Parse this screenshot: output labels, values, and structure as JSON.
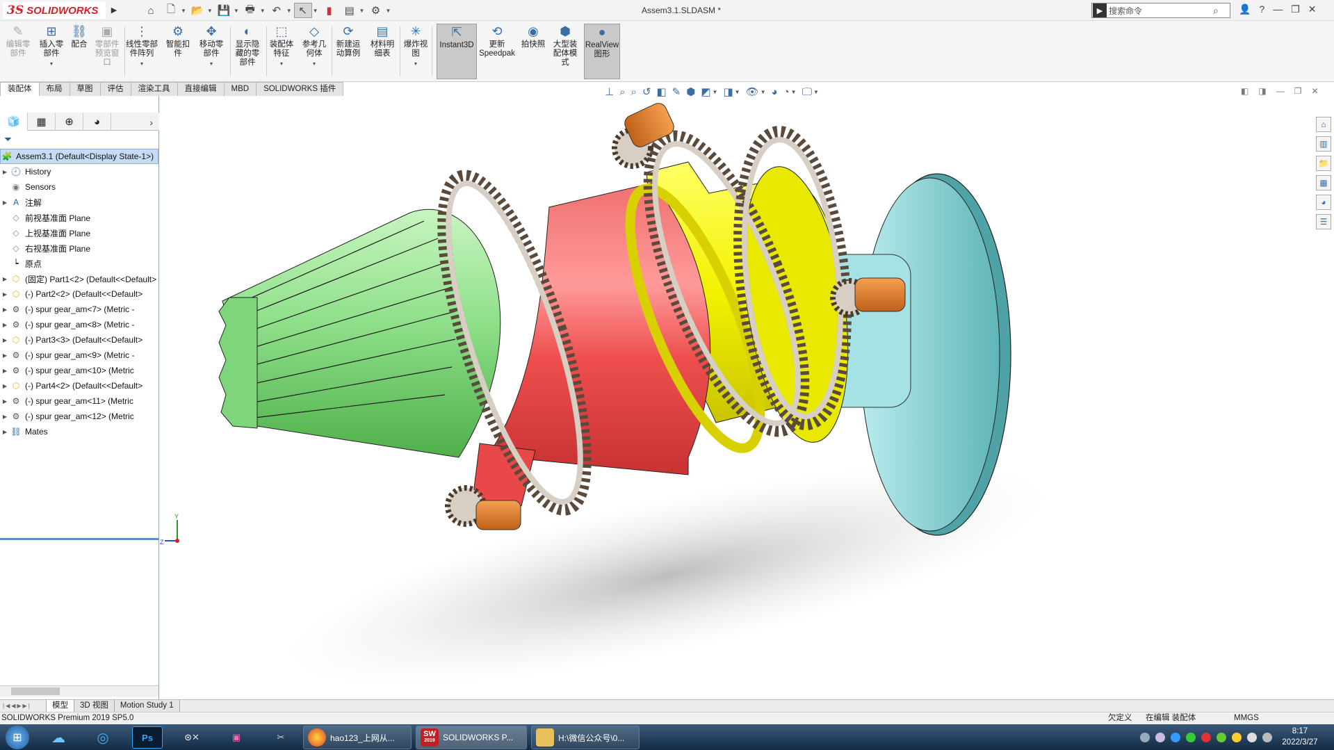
{
  "app": {
    "logo_ds": "3S",
    "logo_text": "SOLIDWORKS",
    "document_title": "Assem3.1.SLDASM *",
    "search_placeholder": "搜索命令",
    "help_glyph": "?"
  },
  "ribbon": {
    "buttons": [
      {
        "label": "编辑零\n部件",
        "icon": "edit-component-icon",
        "enabled": false
      },
      {
        "label": "插入零\n部件",
        "icon": "insert-component-icon",
        "enabled": true
      },
      {
        "label": "配合",
        "icon": "mate-icon",
        "enabled": true
      },
      {
        "label": "零部件\n预览窗\n口",
        "icon": "component-preview-icon",
        "enabled": false
      },
      {
        "label": "线性零部\n件阵列",
        "icon": "linear-pattern-icon",
        "enabled": true
      },
      {
        "label": "智能扣\n件",
        "icon": "smart-fasteners-icon",
        "enabled": true
      },
      {
        "label": "移动零\n部件",
        "icon": "move-component-icon",
        "enabled": true
      },
      {
        "label": "显示隐\n藏的零\n部件",
        "icon": "show-hidden-icon",
        "enabled": true
      },
      {
        "label": "装配体\n特征",
        "icon": "assembly-features-icon",
        "enabled": true
      },
      {
        "label": "参考几\n何体",
        "icon": "reference-geometry-icon",
        "enabled": true
      },
      {
        "label": "新建运\n动算例",
        "icon": "motion-study-icon",
        "enabled": true
      },
      {
        "label": "材料明\n细表",
        "icon": "bom-icon",
        "enabled": true
      },
      {
        "label": "爆炸视\n图",
        "icon": "exploded-view-icon",
        "enabled": true
      },
      {
        "label": "Instant3D",
        "icon": "instant3d-icon",
        "enabled": true
      },
      {
        "label": "更新\nSpeedpak",
        "icon": "speedpak-icon",
        "enabled": true
      },
      {
        "label": "拍快照",
        "icon": "snapshot-icon",
        "enabled": true
      },
      {
        "label": "大型装\n配体模\n式",
        "icon": "large-assembly-icon",
        "enabled": true
      },
      {
        "label": "RealView\n图形",
        "icon": "realview-icon",
        "enabled": true
      }
    ]
  },
  "command_tabs": [
    "装配体",
    "布局",
    "草图",
    "评估",
    "渲染工具",
    "直接编辑",
    "MBD",
    "SOLIDWORKS 插件"
  ],
  "active_command_tab": "装配体",
  "feature_tree": {
    "root": "Assem3.1  (Default<Display State-1>)",
    "items": [
      {
        "label": "History",
        "icon": "history-icon",
        "expandable": true
      },
      {
        "label": "Sensors",
        "icon": "sensors-icon",
        "expandable": false
      },
      {
        "label": "注解",
        "icon": "annotations-icon",
        "expandable": true
      },
      {
        "label": "前视基准面 Plane",
        "icon": "plane-icon",
        "expandable": false
      },
      {
        "label": "上视基准面 Plane",
        "icon": "plane-icon",
        "expandable": false
      },
      {
        "label": "右视基准面 Plane",
        "icon": "plane-icon",
        "expandable": false
      },
      {
        "label": "原点",
        "icon": "origin-icon",
        "expandable": false
      },
      {
        "label": "(固定) Part1<2> (Default<<Default>",
        "icon": "part-icon",
        "expandable": true
      },
      {
        "label": "(-) Part2<2> (Default<<Default>",
        "icon": "part-icon",
        "expandable": true
      },
      {
        "label": "(-) spur gear_am<7> (Metric -",
        "icon": "toolbox-part-icon",
        "expandable": true
      },
      {
        "label": "(-) spur gear_am<8> (Metric -",
        "icon": "toolbox-part-icon",
        "expandable": true
      },
      {
        "label": "(-) Part3<3> (Default<<Default>",
        "icon": "part-icon",
        "expandable": true
      },
      {
        "label": "(-) spur gear_am<9> (Metric -",
        "icon": "toolbox-part-icon",
        "expandable": true
      },
      {
        "label": "(-) spur gear_am<10> (Metric",
        "icon": "toolbox-part-icon",
        "expandable": true
      },
      {
        "label": "(-) Part4<2> (Default<<Default>",
        "icon": "part-icon",
        "expandable": true
      },
      {
        "label": "(-) spur gear_am<11> (Metric",
        "icon": "toolbox-part-icon",
        "expandable": true
      },
      {
        "label": "(-) spur gear_am<12> (Metric",
        "icon": "toolbox-part-icon",
        "expandable": true
      },
      {
        "label": "Mates",
        "icon": "mates-icon",
        "expandable": true
      }
    ]
  },
  "bottom_tabs": [
    "模型",
    "3D 视图",
    "Motion Study 1"
  ],
  "active_bottom_tab": "模型",
  "status": {
    "product": "SOLIDWORKS Premium 2019 SP5.0",
    "definition": "欠定义",
    "mode": "在编辑 装配体",
    "units": "MMGS"
  },
  "triad": {
    "y": "Y",
    "z": "Z"
  },
  "taskbar": {
    "windows": [
      {
        "label": "hao123_上网从...",
        "icon": "browser-icon"
      },
      {
        "label": "SOLIDWORKS P...",
        "icon": "solidworks-icon"
      },
      {
        "label": "H:\\微信公众号\\0...",
        "icon": "folder-icon"
      }
    ],
    "sw_badge": "2019",
    "ps_label": "Ps",
    "time": "8:17",
    "date": "2022/3/27"
  },
  "colors": {
    "brand_red": "#d42027",
    "cone_green": "#8fe08a",
    "drum_red": "#ee4e4e",
    "drum_yellow": "#f2f200",
    "disc_cyan": "#8fd4d6",
    "shaft_orange": "#e07b20",
    "gear_beige": "#d8cfc4"
  }
}
